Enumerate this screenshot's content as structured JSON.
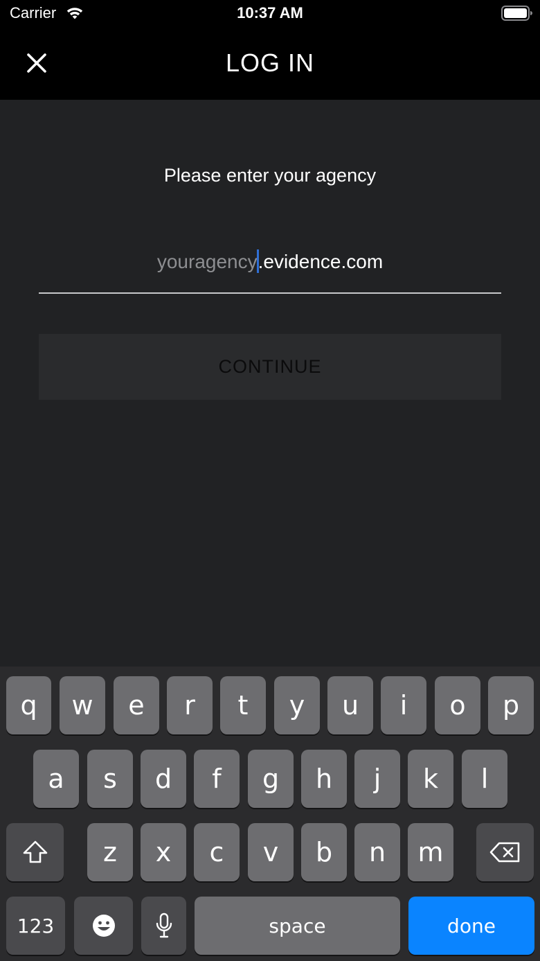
{
  "status_bar": {
    "carrier": "Carrier",
    "time": "10:37 AM",
    "wifi_icon": "wifi-icon",
    "battery_icon": "battery-icon"
  },
  "nav": {
    "title": "LOG IN",
    "close_icon": "close-icon"
  },
  "form": {
    "prompt": "Please enter your agency",
    "agency_placeholder": "youragency",
    "agency_suffix": ".evidence.com",
    "continue_label": "CONTINUE"
  },
  "keyboard": {
    "row1": [
      "q",
      "w",
      "e",
      "r",
      "t",
      "y",
      "u",
      "i",
      "o",
      "p"
    ],
    "row2": [
      "a",
      "s",
      "d",
      "f",
      "g",
      "h",
      "j",
      "k",
      "l"
    ],
    "row3": [
      "z",
      "x",
      "c",
      "v",
      "b",
      "n",
      "m"
    ],
    "numbers_label": "123",
    "space_label": "space",
    "done_label": "done",
    "shift_icon": "shift-icon",
    "delete_icon": "delete-icon",
    "emoji_icon": "emoji-icon",
    "mic_icon": "microphone-icon"
  },
  "colors": {
    "content_bg": "#212224",
    "keyboard_bg": "#2b2b2d",
    "key": "#6d6d70",
    "function_key": "#4a4a4d",
    "done_key": "#0a84ff",
    "cursor": "#2f6fd6"
  }
}
